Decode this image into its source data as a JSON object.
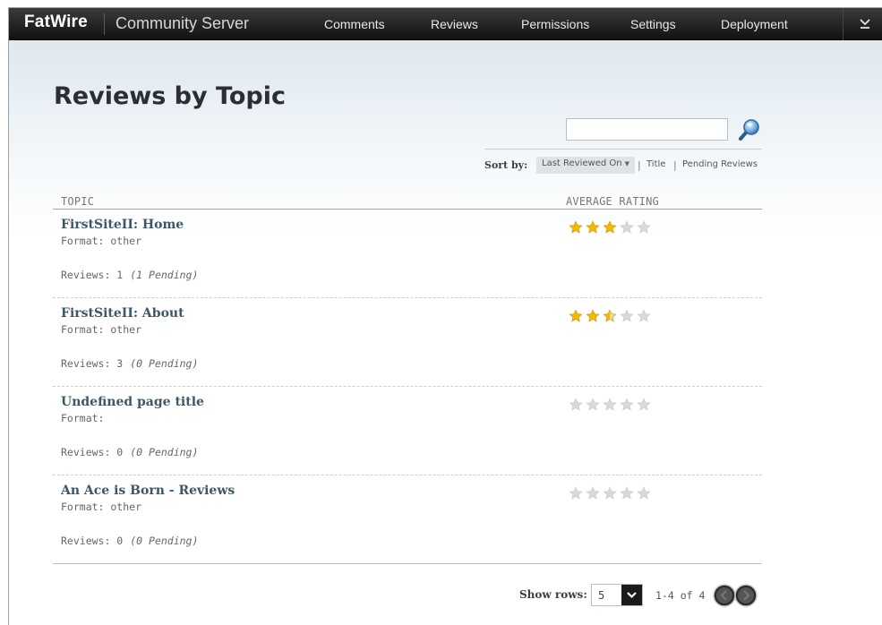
{
  "nav": {
    "brand": "FatWire",
    "product": "Community Server",
    "items": [
      "Comments",
      "Reviews",
      "Permissions",
      "Settings",
      "Deployment"
    ]
  },
  "page": {
    "title": "Reviews by Topic"
  },
  "search": {
    "value": "",
    "placeholder": ""
  },
  "sort": {
    "label": "Sort by:",
    "selected": "Last Reviewed On",
    "pipe": "|",
    "options": [
      "Title",
      "Pending Reviews"
    ]
  },
  "table": {
    "headers": {
      "topic": "TOPIC",
      "rating": "AVERAGE RATING"
    },
    "rows": [
      {
        "title": "FirstSiteII: Home",
        "format": "Format: other",
        "reviews": "Reviews: 1",
        "pending": "(1 Pending)",
        "rating": 3
      },
      {
        "title": "FirstSiteII: About",
        "format": "Format: other",
        "reviews": "Reviews: 3",
        "pending": "(0 Pending)",
        "rating": 2.5
      },
      {
        "title": "Undefined page title",
        "format": "Format:",
        "reviews": "Reviews: 0",
        "pending": "(0 Pending)",
        "rating": 0
      },
      {
        "title": "An Ace is Born - Reviews",
        "format": "Format: other",
        "reviews": "Reviews: 0",
        "pending": "(0 Pending)",
        "rating": 0
      }
    ]
  },
  "pager": {
    "label": "Show rows:",
    "rows_value": "5",
    "range": "1-4 of 4"
  },
  "colors": {
    "star_on": "#f5b800",
    "star_off": "#d9d9d9",
    "title_link": "#3d5766",
    "topbar": "#262626"
  },
  "icons": {
    "search": "magnifier-icon",
    "menu": "chevron-down-icon",
    "prev": "prev-icon",
    "next": "next-icon",
    "star": "star-icon"
  }
}
